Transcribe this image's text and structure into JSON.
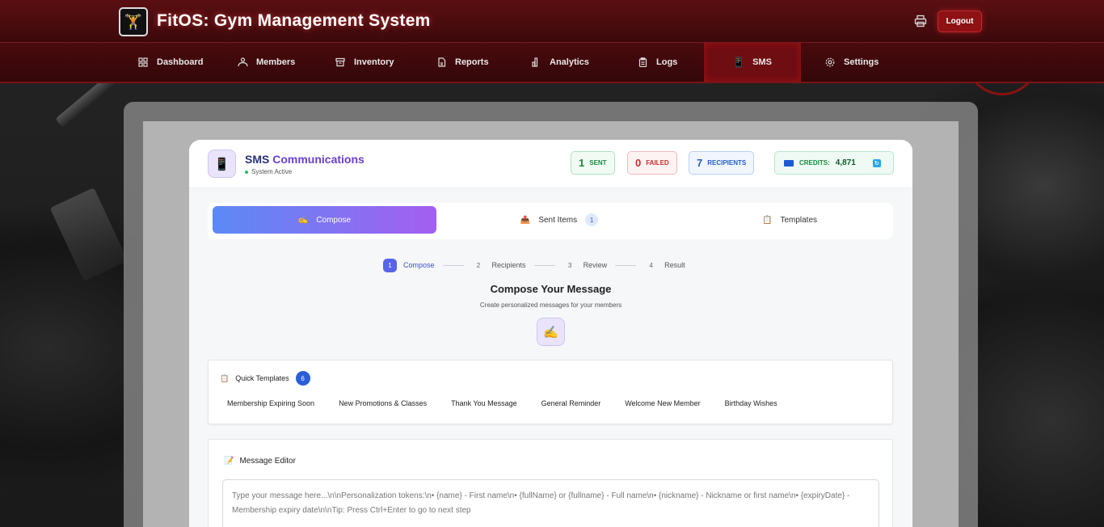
{
  "app": {
    "title": "FitOS: Gym Management System",
    "logout_label": "Logout"
  },
  "nav": {
    "items": [
      {
        "label": "Dashboard",
        "icon": "grid-icon"
      },
      {
        "label": "Members",
        "icon": "members-icon"
      },
      {
        "label": "Inventory",
        "icon": "archive-icon"
      },
      {
        "label": "Reports",
        "icon": "file-icon"
      },
      {
        "label": "Analytics",
        "icon": "chart-icon"
      },
      {
        "label": "Logs",
        "icon": "clipboard-icon"
      },
      {
        "label": "SMS",
        "icon": "phone-icon",
        "active": true
      },
      {
        "label": "Settings",
        "icon": "gear-icon"
      }
    ]
  },
  "sms": {
    "title_part1": "SMS",
    "title_part2": "Communications",
    "status": "System Active",
    "stats": {
      "sent_num": "1",
      "sent_label": "SENT",
      "failed_num": "0",
      "failed_label": "FAILED",
      "recipients_num": "7",
      "recipients_label": "RECIPIENTS",
      "credits_label": "CREDITS:",
      "credits_value": "4,871"
    }
  },
  "tabs": {
    "compose": "Compose",
    "sent_items": "Sent Items",
    "sent_items_count": "1",
    "templates": "Templates"
  },
  "stepper": {
    "steps": [
      {
        "num": "1",
        "label": "Compose",
        "active": true
      },
      {
        "num": "2",
        "label": "Recipients"
      },
      {
        "num": "3",
        "label": "Review"
      },
      {
        "num": "4",
        "label": "Result"
      }
    ]
  },
  "compose": {
    "title": "Compose Your Message",
    "subtitle": "Create personalized messages for your members"
  },
  "quick_templates": {
    "label": "Quick Templates",
    "count": "6",
    "items": [
      "Membership Expiring Soon",
      "New Promotions & Classes",
      "Thank You Message",
      "General Reminder",
      "Welcome New Member",
      "Birthday Wishes"
    ]
  },
  "editor": {
    "label": "Message Editor",
    "placeholder": "Type your message here...\\n\\nPersonalization tokens:\\n• {name} - First name\\n• {fullName} or {fullname} - Full name\\n• {nickname} - Nickname or first name\\n• {expiryDate} - Membership expiry date\\n\\nTip: Press Ctrl+Enter to go to next step"
  },
  "colors": {
    "brand_red": "#8e1114",
    "accent_gradient_start": "#5b8af5",
    "accent_gradient_end": "#a45ff0",
    "success": "#178a3d",
    "danger": "#d12a2a",
    "info": "#2360c9"
  }
}
